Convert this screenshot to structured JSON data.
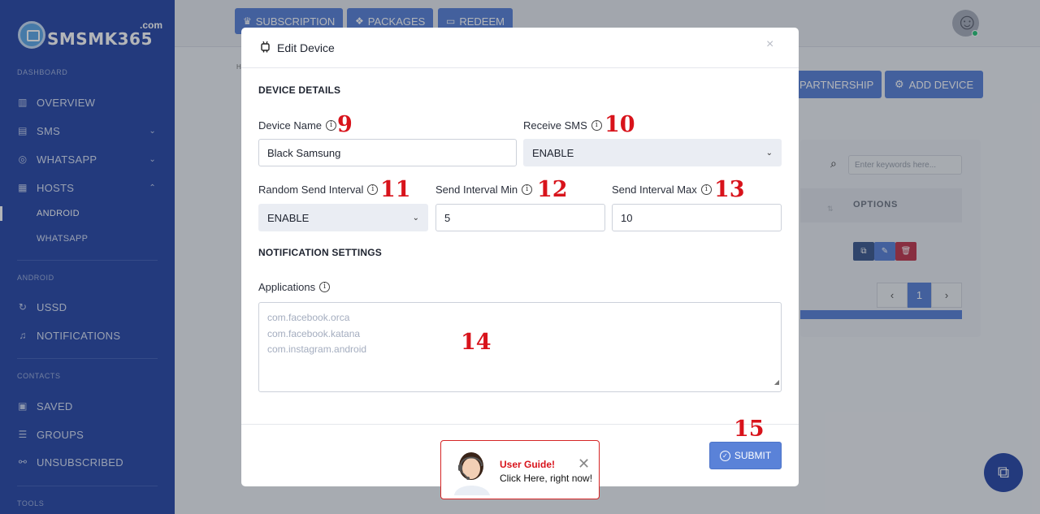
{
  "sidebar": {
    "logo_text": "SMSMK365",
    "logo_com": ".com",
    "sections": {
      "dashboard": "DASHBOARD",
      "android": "ANDROID",
      "contacts": "CONTACTS",
      "tools": "TOOLS"
    },
    "items": {
      "overview": "OVERVIEW",
      "sms": "SMS",
      "whatsapp": "WHATSAPP",
      "hosts": "HOSTS",
      "hosts_android": "ANDROID",
      "hosts_whatsapp": "WHATSAPP",
      "ussd": "USSD",
      "notifications": "NOTIFICATIONS",
      "saved": "SAVED",
      "groups": "GROUPS",
      "unsubscribed": "UNSUBSCRIBED"
    }
  },
  "topbar": {
    "subscription": "SUBSCRIPTION",
    "packages": "PACKAGES",
    "redeem": "REDEEM"
  },
  "page": {
    "breadcrumb_fragment": "H",
    "partnership_label": "PARTNERSHIP",
    "add_device_label": "ADD DEVICE",
    "search_placeholder": "Enter keywords here...",
    "options_header": "OPTIONS",
    "current_page": "1"
  },
  "modal": {
    "title": "Edit Device",
    "device_details_title": "DEVICE DETAILS",
    "device_name_label": "Device Name",
    "device_name_value": "Black Samsung",
    "receive_sms_label": "Receive SMS",
    "receive_sms_value": "ENABLE",
    "random_interval_label": "Random Send Interval",
    "random_interval_value": "ENABLE",
    "interval_min_label": "Send Interval Min",
    "interval_min_value": "5",
    "interval_max_label": "Send Interval Max",
    "interval_max_value": "10",
    "notification_title": "NOTIFICATION SETTINGS",
    "applications_label": "Applications",
    "applications_placeholder": [
      "com.facebook.orca",
      "com.facebook.katana",
      "com.instagram.android"
    ],
    "submit_label": "SUBMIT"
  },
  "annotations": {
    "n9": "9",
    "n10": "10",
    "n11": "11",
    "n12": "12",
    "n13": "13",
    "n14": "14",
    "n15": "15"
  },
  "guide": {
    "title": "User Guide!",
    "subtitle": "Click Here, right now!"
  },
  "colors": {
    "sidebar": "#2c4ba8",
    "accent": "#5a82d8",
    "annotation": "#d8131b"
  }
}
